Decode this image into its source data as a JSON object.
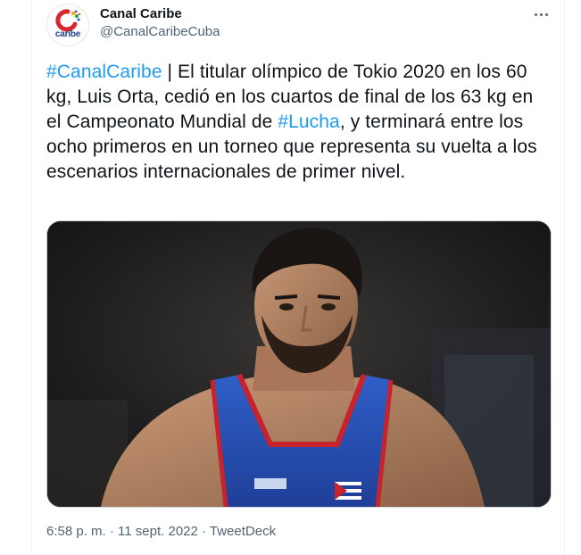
{
  "account": {
    "display_name": "Canal Caribe",
    "handle": "@CanalCaribeCuba",
    "avatar_text": "caribe"
  },
  "tweet": {
    "hashtag1": "#CanalCaribe",
    "text1": " | El titular olímpico de Tokio 2020 en los 60 kg, Luis Orta, cedió en los cuartos de final de los 63 kg en el Campeonato Mundial de ",
    "hashtag2": "#Lucha",
    "text2": ", y terminará entre los ocho primeros en un torneo que representa su vuelta a los escenarios internacionales de primer nivel."
  },
  "meta": {
    "time": "6:58 p. m.",
    "separator": " · ",
    "date": "11 sept. 2022",
    "source": "TweetDeck"
  },
  "icons": {
    "more": "more-options-icon",
    "avatar": "canal-caribe-logo"
  },
  "colors": {
    "link": "#1d9bf0",
    "text": "#0f1419",
    "muted": "#536471"
  }
}
